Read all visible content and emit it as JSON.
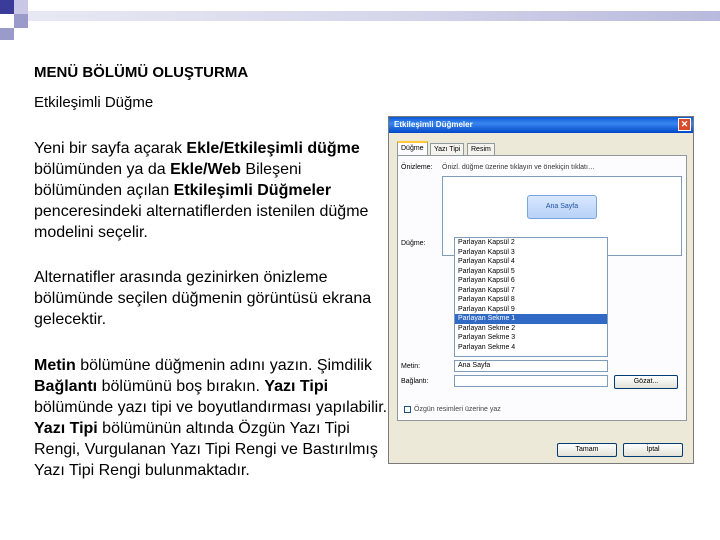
{
  "slide": {
    "title": "MENÜ BÖLÜMÜ OLUŞTURMA",
    "subtitle": "Etkileşimli Düğme",
    "para1": [
      {
        "t": "Yeni bir sayfa açarak ",
        "b": false
      },
      {
        "t": "Ekle/Etkileşimli düğme",
        "b": true
      },
      {
        "t": " bölümünden ya da ",
        "b": false
      },
      {
        "t": "Ekle/Web",
        "b": true
      },
      {
        "t": " Bileşeni bölümünden açılan ",
        "b": false
      },
      {
        "t": "Etkileşimli Düğmeler",
        "b": true
      },
      {
        "t": " penceresindeki alternatiflerden istenilen düğme modelini seçelir.",
        "b": false
      }
    ],
    "para2": [
      {
        "t": "Alternatifler arasında gezinirken önizleme bölümünde seçilen düğmenin görüntüsü ekrana gelecektir.",
        "b": false
      }
    ],
    "para3": [
      {
        "t": "Metin",
        "b": true
      },
      {
        "t": " bölümüne düğmenin adını yazın. Şimdilik ",
        "b": false
      },
      {
        "t": "Bağlantı",
        "b": true
      },
      {
        "t": " bölümünü boş bırakın. ",
        "b": false
      },
      {
        "t": "Yazı Tipi",
        "b": true
      },
      {
        "t": " bölümünde yazı tipi ve boyutlandırması yapılabilir. ",
        "b": false
      },
      {
        "t": "Yazı Tipi",
        "b": true
      },
      {
        "t": " bölümünün altında Özgün Yazı Tipi Rengi, Vurgulanan Yazı Tipi Rengi ve Bastırılmış Yazı Tipi Rengi bulunmaktadır.",
        "b": false
      }
    ]
  },
  "dialog": {
    "title": "Etkileşimli Düğmeler",
    "close_glyph": "✕",
    "tabs": [
      "Düğme",
      "Yazı Tipi",
      "Resim"
    ],
    "preview_label": "Önizleme:",
    "preview_hint": "Önizl. düğme üzerine tıklayın ve önekiçin tıklatı…",
    "preview_button": "Ana Sayfa",
    "dugme_label": "Düğme:",
    "list": [
      "Parlayan Kapsül 2",
      "Parlayan Kapsül 3",
      "Parlayan Kapsül 4",
      "Parlayan Kapsül 5",
      "Parlayan Kapsül 6",
      "Parlayan Kapsül 7",
      "Parlayan Kapsül 8",
      "Parlayan Kapsül 9",
      "Parlayan Sekme 1",
      "Parlayan Sekme 2",
      "Parlayan Sekme 3",
      "Parlayan Sekme 4"
    ],
    "selected_index": 8,
    "metin_label": "Metin:",
    "metin_value": "Ana Sayfa",
    "baglanti_label": "Bağlantı:",
    "gozat_label": "Gözat...",
    "ozgun_label": "Özgün resimleri üzerine yaz",
    "ok_label": "Tamam",
    "cancel_label": "İptal"
  }
}
